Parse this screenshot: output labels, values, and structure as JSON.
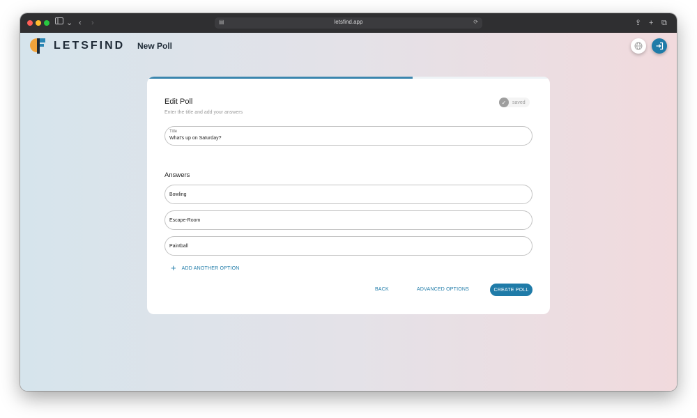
{
  "browser": {
    "url": "letsfind.app"
  },
  "header": {
    "brand": "LETSFIND",
    "page_title": "New Poll"
  },
  "card": {
    "progress_percent": 66,
    "title": "Edit Poll",
    "subtitle": "Enter the title and add your answers",
    "saved_status": "saved",
    "title_field": {
      "label": "Title",
      "value": "What's up on Saturday?"
    },
    "answers_heading": "Answers",
    "answers": [
      "Bowling",
      "Escape-Room",
      "Paintball"
    ],
    "add_option_label": "ADD ANOTHER OPTION",
    "back_label": "BACK",
    "advanced_label": "ADVANCED OPTIONS",
    "create_label": "CREATE POLL"
  },
  "colors": {
    "accent": "#1f7ba8",
    "progress": "#3b86ae",
    "logo_orange": "#f2a33a",
    "logo_teal": "#2a86b4",
    "logo_dark": "#1e2a36"
  },
  "icons": {
    "lang_button": "globe-icon",
    "login_button": "login-icon",
    "saved": "check-icon",
    "add_option": "plus-icon"
  }
}
